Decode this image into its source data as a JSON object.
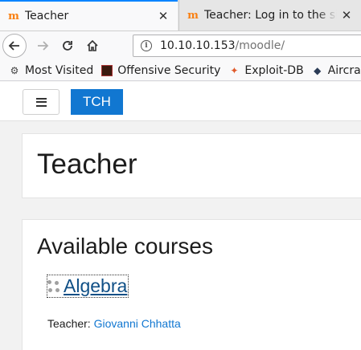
{
  "browser": {
    "tabs": [
      {
        "title": "Teacher",
        "favicon": "moodle-icon",
        "active": true
      },
      {
        "title": "Teacher: Log in to the site",
        "favicon": "moodle-icon",
        "active": false
      }
    ],
    "url_host": "10.10.10.153",
    "url_path": "/moodle/",
    "bookmarks": [
      {
        "label": "Most Visited",
        "icon": "gear-icon"
      },
      {
        "label": "Offensive Security",
        "icon": "offsec-icon"
      },
      {
        "label": "Exploit-DB",
        "icon": "exploit-db-icon"
      },
      {
        "label": "Aircrack-ng",
        "icon": "aircrack-icon"
      }
    ]
  },
  "site": {
    "brand_button": "TCH",
    "page_title": "Teacher",
    "section_title": "Available courses",
    "course": {
      "name": "Algebra",
      "teacher_label": "Teacher: ",
      "teacher_name": "Giovanni Chhatta"
    }
  },
  "colors": {
    "brand": "#1177d1",
    "link": "#0f4f86",
    "tab_accent": "#0a84ff"
  }
}
